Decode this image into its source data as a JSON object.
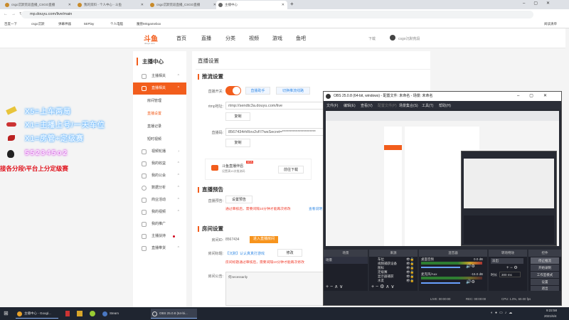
{
  "browser": {
    "tabs": [
      {
        "label": "csgo沉默荒段直播_CSGO直播"
      },
      {
        "label": "我的资料 - 个人中心 - 斗鱼"
      },
      {
        "label": "csgo沉默荒段直播_CSGO直播"
      },
      {
        "label": "主播中心"
      }
    ],
    "new_tab": "+",
    "url": "mp.douyu.com/live/main",
    "bookmarks": [
      "百度一下",
      "csgo沉默",
      "弹幕神器",
      "5EPlay",
      "个人电脑",
      "魔兽MSgamebox"
    ],
    "reading_list": "阅读清单"
  },
  "site": {
    "logo": "斗鱼",
    "logo_sub": "douyu.com",
    "nav": [
      "首页",
      "直播",
      "分类",
      "视频",
      "游戏",
      "鱼吧"
    ],
    "download": "下载",
    "username": "csgo沉默荒段"
  },
  "sidebar": {
    "title": "主播中心",
    "items": [
      {
        "label": "主播相关",
        "caret": "^"
      },
      {
        "label": "直播相关",
        "caret": "^",
        "selected": true
      },
      {
        "label": "房间管理",
        "sub": true
      },
      {
        "label": "直播设置",
        "sub": true,
        "active": true
      },
      {
        "label": "直播记录",
        "sub": true
      },
      {
        "label": "短时视频",
        "sub": true
      },
      {
        "label": "视频轮播",
        "caret": "›"
      },
      {
        "label": "我的收益",
        "caret": "^"
      },
      {
        "label": "我的公会",
        "caret": "^"
      },
      {
        "label": "数据分析",
        "caret": "^"
      },
      {
        "label": "商业活动",
        "caret": "^"
      },
      {
        "label": "我的视频",
        "caret": "^"
      },
      {
        "label": "我的推广"
      },
      {
        "label": "主播扶持",
        "dot": true
      },
      {
        "label": "直播带货",
        "caret": "^"
      }
    ]
  },
  "main": {
    "title": "直播设置",
    "push": {
      "heading": "推流设置",
      "switch_label": "直播开关:",
      "switch_on": true,
      "btn1": "直播助手",
      "btn2": "切换推流线路",
      "rtmp_label": "rtmp地址:",
      "rtmp_value": "rtmp://sendtc3a.douyu.com/live",
      "copy1": "复制",
      "key_label": "直播码:",
      "key_value": "8567434rhRov2vFI?wsSecret=**********************",
      "copy2": "复制"
    },
    "promo": {
      "title": "斗鱼直播伴侣",
      "sub": "设置满10次推流码",
      "badge": "NEW",
      "button": "前往下载"
    },
    "preview": {
      "heading": "直播预告",
      "label": "直播预告:",
      "button": "设置预告",
      "note": "通过审核后，需要间隔10分钟才能再次修改",
      "link": "查看说明"
    },
    "room": {
      "heading": "房间设置",
      "id_label": "房间ID:",
      "id_value": "8567434",
      "enter": "进入直播房间",
      "title_label": "房间标题:",
      "title_value": "【沉默】认认真真打游戏",
      "edit": "修改",
      "title_note": "房间标题通过审核后，需要间隔10分钟才能再次修改",
      "notice_label": "房间公告:",
      "notice_value": "何necessarily"
    }
  },
  "overlay": {
    "lines": [
      "X5=上车两局",
      "X1=主播上号/一天车位",
      "X1=房管+定级赛"
    ],
    "qq": "552345o2",
    "footer": "接各分段\\平台上分定级赛"
  },
  "obs": {
    "title": "OBS 25.0.8 (64-bit, windows) - 配置文件: 未命名 - 场景: 未命名",
    "menu": [
      "文件(F)",
      "编辑(E)",
      "查看(V)",
      "配置文件(P)",
      "场景集合(S)",
      "工具(T)",
      "帮助(H)"
    ],
    "docks": {
      "scenes": "场景",
      "sources": "来源",
      "mixer": "混音器",
      "transitions": "转场特效",
      "controls": "控件"
    },
    "scene_items": [
      "场景"
    ],
    "sources": [
      "车位",
      "视频捕获设备",
      "图标",
      "定级赛",
      "显示器捕获",
      "水友"
    ],
    "mixer": [
      {
        "name": "桌面音频",
        "db": "0.0 dB",
        "level": 0.7
      },
      {
        "name": "麦克风/Aux",
        "db": "-15.0 dB",
        "level": 0.3
      }
    ],
    "transition": "淡出",
    "duration_label": "时长",
    "duration": "300 ms",
    "controls": [
      "停止推流",
      "开始录制",
      "工作室模式",
      "设置",
      "退出"
    ],
    "status": {
      "live": "LIVE: 00:00:00",
      "rec": "REC: 00:00:00",
      "cpu": "CPU: 1.0%, 60.00 fps"
    }
  },
  "taskbar": {
    "items": [
      "主播中心 - Googl...",
      "Steam",
      "OBS 25.0.8 (64-bi..."
    ],
    "time": "9:22:58",
    "date": "2021/6/4"
  },
  "colors": {
    "accent": "#f25d1c",
    "obs_bg": "#272a33"
  }
}
